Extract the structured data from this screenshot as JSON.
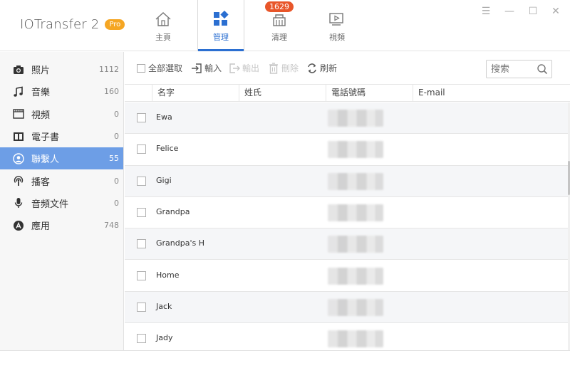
{
  "app": {
    "name": "IOTransfer 2",
    "edition": "Pro"
  },
  "nav_tabs": [
    {
      "label": "主頁",
      "icon": "home-icon"
    },
    {
      "label": "管理",
      "icon": "manage-grid-icon"
    },
    {
      "label": "清理",
      "icon": "clean-broom-icon",
      "badge": "1629"
    },
    {
      "label": "視頻",
      "icon": "video-icon"
    }
  ],
  "window_controls": {
    "menu": "☰",
    "minimize": "—",
    "maximize": "☐",
    "close": "✕"
  },
  "sidebar": {
    "items": [
      {
        "label": "照片",
        "count": "1112",
        "icon": "camera-icon"
      },
      {
        "label": "音樂",
        "count": "160",
        "icon": "music-note-icon"
      },
      {
        "label": "視頻",
        "count": "0",
        "icon": "film-icon"
      },
      {
        "label": "電子書",
        "count": "0",
        "icon": "book-icon"
      },
      {
        "label": "聯繫人",
        "count": "55",
        "icon": "contact-person-icon"
      },
      {
        "label": "播客",
        "count": "0",
        "icon": "podcast-icon"
      },
      {
        "label": "音頻文件",
        "count": "0",
        "icon": "microphone-icon"
      },
      {
        "label": "應用",
        "count": "748",
        "icon": "app-store-icon"
      }
    ]
  },
  "toolbar": {
    "select_all": "全部選取",
    "import": "輸入",
    "export": "輸出",
    "delete": "刪除",
    "refresh": "刷新",
    "search_placeholder": "搜索"
  },
  "table": {
    "headers": [
      "名字",
      "姓氏",
      "電話號碼",
      "E-mail"
    ],
    "rows": [
      {
        "first_name": "Ewa"
      },
      {
        "first_name": "Felice"
      },
      {
        "first_name": "Gigi"
      },
      {
        "first_name": "Grandpa"
      },
      {
        "first_name": "Grandpa's H"
      },
      {
        "first_name": "Home"
      },
      {
        "first_name": "Jack"
      },
      {
        "first_name": "Jady"
      }
    ]
  },
  "colors": {
    "accent": "#2b6fd1",
    "sidebar_active": "#6d9ee6",
    "pro_badge": "#f5a623",
    "count_badge": "#e8562a"
  }
}
